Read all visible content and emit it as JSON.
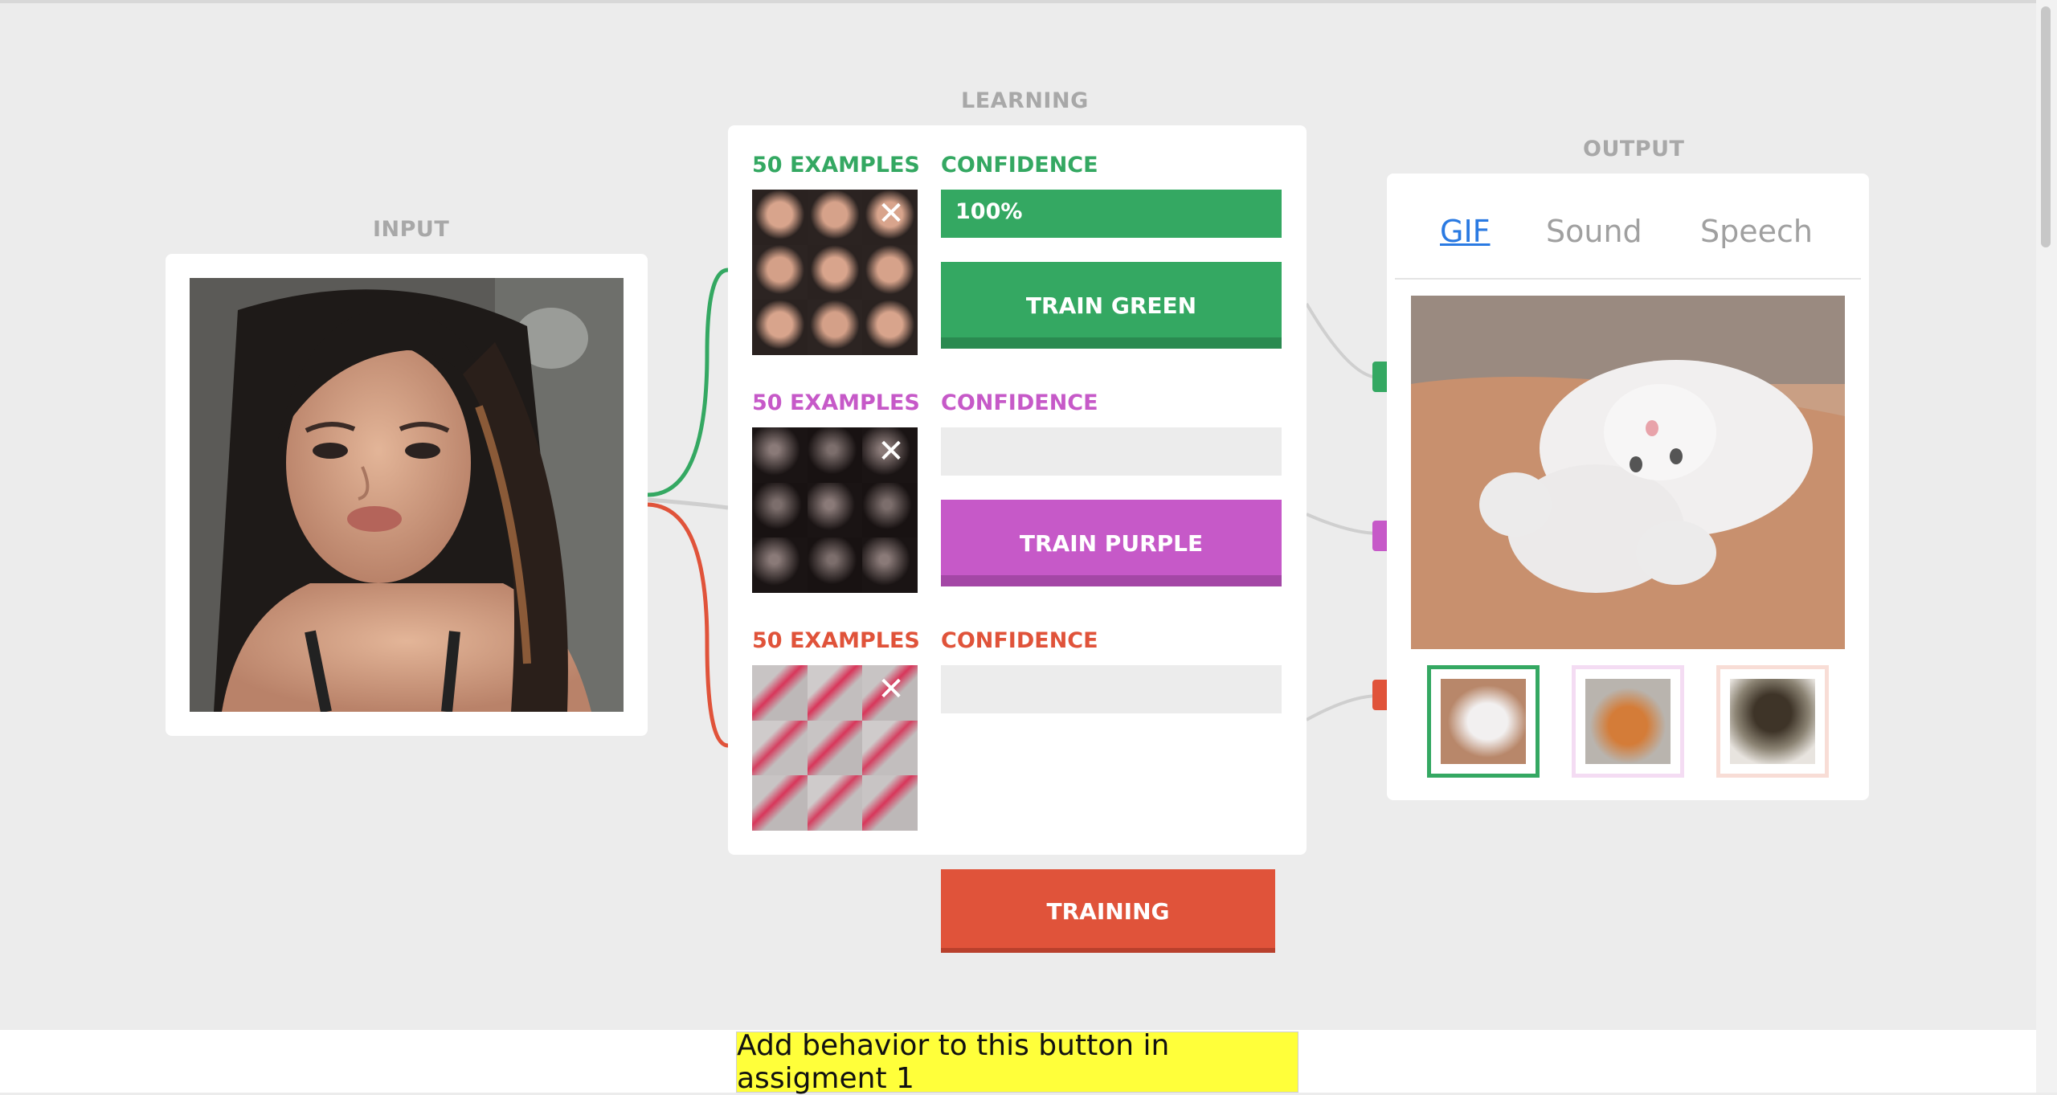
{
  "sections": {
    "input": "INPUT",
    "learning": "LEARNING",
    "output": "OUTPUT"
  },
  "classes": [
    {
      "id": "green",
      "color": "#34a862",
      "examples": "50 EXAMPLES",
      "confidence_label": "CONFIDENCE",
      "confidence_value": "100%",
      "confidence": 1.0,
      "button": "TRAIN GREEN"
    },
    {
      "id": "purple",
      "color": "#c659c8",
      "examples": "50 EXAMPLES",
      "confidence_label": "CONFIDENCE",
      "confidence_value": "",
      "confidence": 0.0,
      "button": "TRAIN PURPLE"
    },
    {
      "id": "orange",
      "color": "#e0533a",
      "examples": "50 EXAMPLES",
      "confidence_label": "CONFIDENCE",
      "confidence_value": "",
      "confidence": 0.0,
      "button": "TRAINING"
    }
  ],
  "output": {
    "tabs": [
      "GIF",
      "Sound",
      "Speech"
    ],
    "active_tab": "GIF"
  },
  "icons": {
    "clear": "close-icon"
  },
  "bottom_button": "Add behavior to this button in assigment 1"
}
